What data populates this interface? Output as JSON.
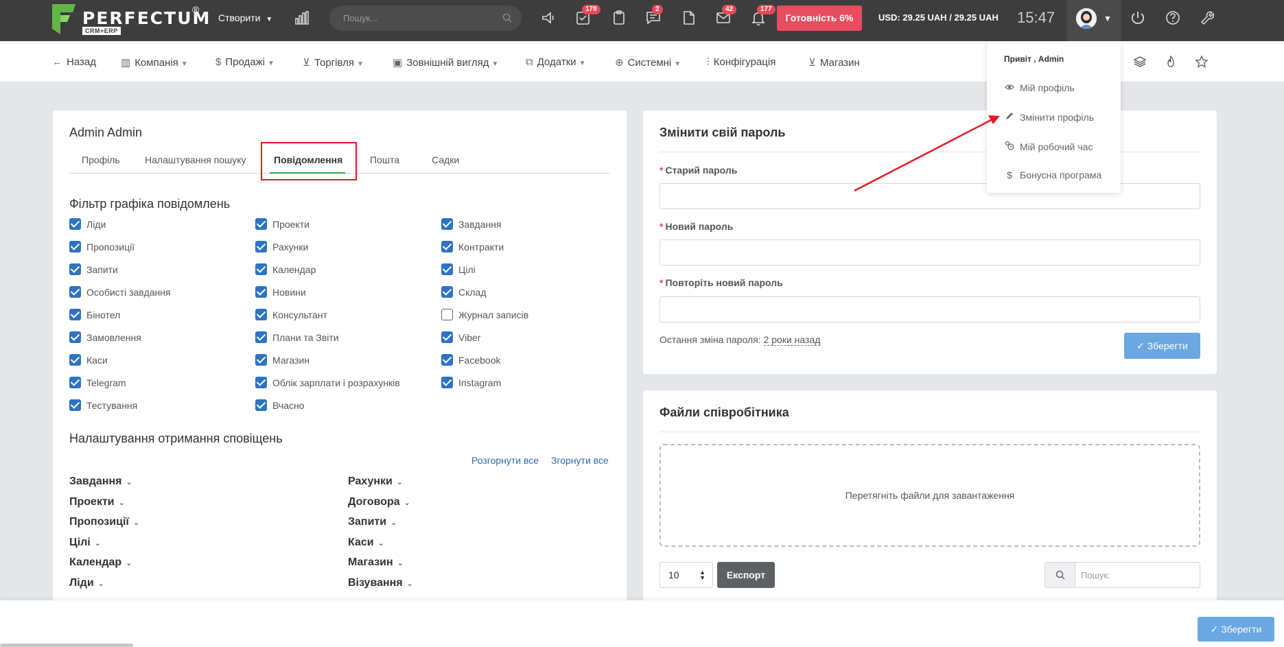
{
  "topbar": {
    "logo_text": "PERFECTUM",
    "logo_reg": "®",
    "logo_sub": "CRM+ERP",
    "create_label": "Створити",
    "search_placeholder": "Пошук...",
    "badges": {
      "tasks": "178",
      "messages": "2",
      "mail": "42",
      "notifications": "177"
    },
    "ready_label": "Готовність 6%",
    "rate": "USD: 29.25 UAH / 29.25 UAH",
    "time": "15:47"
  },
  "subnav": {
    "items": [
      "Назад",
      "Компанія",
      "Продажі",
      "Торгівля",
      "Зовнішній вигляд",
      "Додатки",
      "Системні",
      "Конфігурація",
      "Магазин"
    ]
  },
  "profile": {
    "title": "Admin Admin",
    "tabs": [
      "Профіль",
      "Налаштування пошуку",
      "Повідомлення",
      "Пошта",
      "Садки"
    ],
    "filter_title": "Фільтр графіка повідомлень",
    "checkboxes": [
      {
        "label": "Ліди",
        "checked": true
      },
      {
        "label": "Проекти",
        "checked": true
      },
      {
        "label": "Завдання",
        "checked": true
      },
      {
        "label": "Пропозиції",
        "checked": true
      },
      {
        "label": "Рахунки",
        "checked": true
      },
      {
        "label": "Контракти",
        "checked": true
      },
      {
        "label": "Запити",
        "checked": true
      },
      {
        "label": "Календар",
        "checked": true
      },
      {
        "label": "Цілі",
        "checked": true
      },
      {
        "label": "Особисті завдання",
        "checked": true
      },
      {
        "label": "Новини",
        "checked": true
      },
      {
        "label": "Склад",
        "checked": true
      },
      {
        "label": "Бінотел",
        "checked": true
      },
      {
        "label": "Консультант",
        "checked": true
      },
      {
        "label": "Журнал записів",
        "checked": false
      },
      {
        "label": "Замовлення",
        "checked": true
      },
      {
        "label": "Плани та Звіти",
        "checked": true
      },
      {
        "label": "Viber",
        "checked": true
      },
      {
        "label": "Каси",
        "checked": true
      },
      {
        "label": "Магазин",
        "checked": true
      },
      {
        "label": "Facebook",
        "checked": true
      },
      {
        "label": "Telegram",
        "checked": true
      },
      {
        "label": "Облік зарплати і розрахунків",
        "checked": true
      },
      {
        "label": "Instagram",
        "checked": true
      },
      {
        "label": "Тестування",
        "checked": true
      },
      {
        "label": "Вчасно",
        "checked": true
      }
    ],
    "notif_title": "Налаштування отримання сповіщень",
    "expand_all": "Розгорнути все",
    "collapse_all": "Згорнути все",
    "accordions_left": [
      "Завдання",
      "Проекти",
      "Пропозиції",
      "Цілі",
      "Календар",
      "Ліди"
    ],
    "accordions_right": [
      "Рахунки",
      "Договора",
      "Запити",
      "Каси",
      "Магазин",
      "Візування"
    ]
  },
  "password": {
    "title": "Змінити свій пароль",
    "old_label": "Старий пароль",
    "new_label": "Новий пароль",
    "repeat_label": "Повторіть новий пароль",
    "last_change_label": "Остання зміна пароля:",
    "last_change_value": "2 роки назад",
    "save_label": "Зберегти"
  },
  "files": {
    "title": "Файли співробітника",
    "dropzone_text": "Перетягніть файли для завантаження",
    "page_size": "10",
    "export_label": "Експорт",
    "search_placeholder": "Пошук:"
  },
  "bottom": {
    "save_label": "Зберегти"
  },
  "user_menu": {
    "greeting": "Привіт , Admin",
    "items": [
      {
        "label": "Мій профіль",
        "icon": "eye-icon"
      },
      {
        "label": "Змінити профіль",
        "icon": "pencil-icon"
      },
      {
        "label": "Мій робочий час",
        "icon": "clock-icon"
      },
      {
        "label": "Бонусна програма",
        "icon": "dollar-icon"
      }
    ]
  },
  "colors": {
    "topbar": "#3d3d3d",
    "accent_red": "#e84c5e",
    "checkbox_blue": "#2d73c6",
    "save_blue": "#6ba7e0",
    "tab_green": "#2ea64f",
    "annotation_red": "#e01b24"
  }
}
